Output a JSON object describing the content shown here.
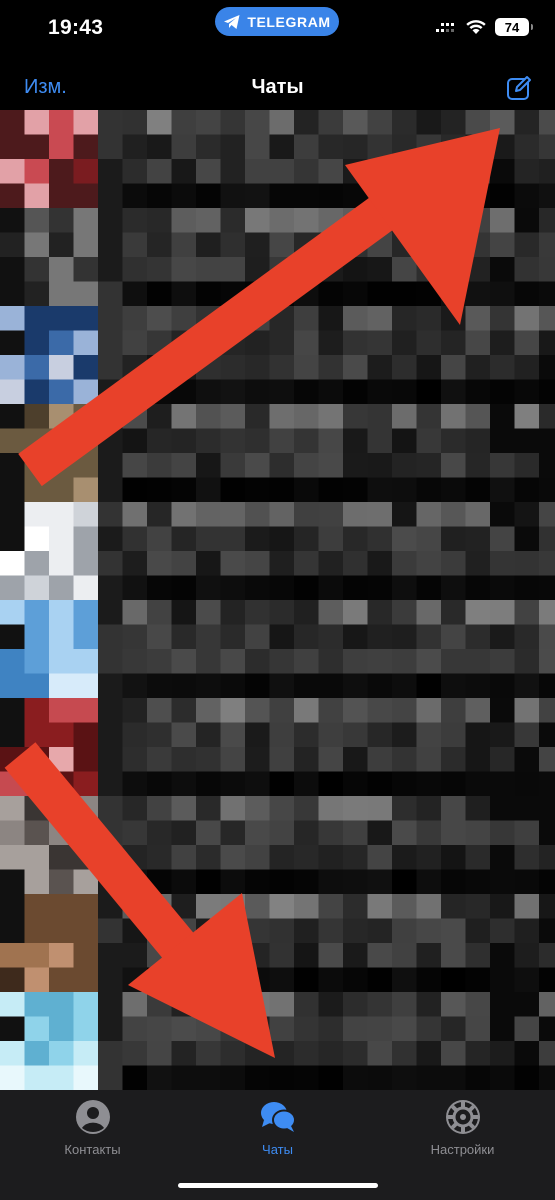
{
  "status_bar": {
    "time": "19:43",
    "app_pill": "TELEGRAM",
    "battery": "74"
  },
  "nav": {
    "edit_label": "Изм.",
    "title": "Чаты",
    "compose_icon": "compose-icon"
  },
  "tabs": [
    {
      "label": "Контакты",
      "icon": "person-icon",
      "active": false
    },
    {
      "label": "Чаты",
      "icon": "chat-bubbles-icon",
      "active": true
    },
    {
      "label": "Настройки",
      "icon": "gear-icon",
      "active": false
    }
  ],
  "colors": {
    "accent": "#3e8cf3",
    "pill": "#3a84e8",
    "arrow": "#e8412a",
    "tab_bar": "#1c1c1e"
  }
}
